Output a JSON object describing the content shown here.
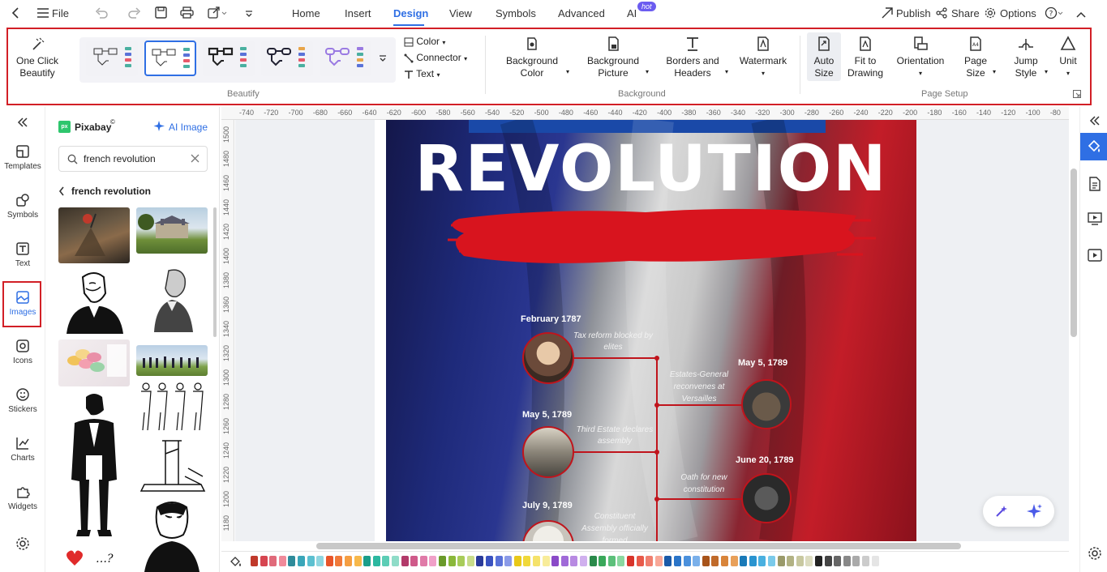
{
  "menubar": {
    "file": "File",
    "tabs": [
      "Home",
      "Insert",
      "Design",
      "View",
      "Symbols",
      "Advanced",
      "AI"
    ],
    "active_tab": "Design",
    "hot_badge": "hot",
    "publish": "Publish",
    "share": "Share",
    "options": "Options"
  },
  "ribbon": {
    "one_click_beautify": "One Click\nBeautify",
    "color": "Color",
    "connector": "Connector",
    "text": "Text",
    "beautify_group": "Beautify",
    "background_color": "Background\nColor",
    "background_picture": "Background\nPicture",
    "borders_headers": "Borders and\nHeaders",
    "watermark": "Watermark",
    "background_group": "Background",
    "auto_size": "Auto\nSize",
    "fit_to_drawing": "Fit to\nDrawing",
    "orientation": "Orientation",
    "page_size": "Page\nSize",
    "jump_style": "Jump\nStyle",
    "unit": "Unit",
    "page_setup_group": "Page Setup"
  },
  "rail": {
    "items": [
      "Templates",
      "Symbols",
      "Text",
      "Images",
      "Icons",
      "Stickers",
      "Charts",
      "Widgets"
    ],
    "active": "Images"
  },
  "panel": {
    "source": "Pixabay",
    "ai_image": "AI Image",
    "search_value": "french revolution",
    "breadcrumb": "french revolution"
  },
  "ruler": {
    "h_ticks": [
      "-740",
      "-720",
      "-700",
      "-680",
      "-660",
      "-640",
      "-620",
      "-600",
      "-580",
      "-560",
      "-540",
      "-520",
      "-500",
      "-480",
      "-460",
      "-440",
      "-420",
      "-400",
      "-380",
      "-360",
      "-340",
      "-320",
      "-300",
      "-280",
      "-260",
      "-240",
      "-220",
      "-200",
      "-180",
      "-160",
      "-140",
      "-120",
      "-100",
      "-80"
    ],
    "v_ticks": [
      "1500",
      "1480",
      "1460",
      "1440",
      "1420",
      "1400",
      "1380",
      "1360",
      "1340",
      "1320",
      "1300",
      "1280",
      "1260",
      "1240",
      "1220",
      "1200",
      "1180"
    ]
  },
  "poster": {
    "title": "REVOLUTION",
    "events": [
      {
        "date": "February 1787",
        "caption": "Tax reform blocked by elites"
      },
      {
        "date": "May 5, 1789",
        "caption": "Estates-General reconvenes at Versailles"
      },
      {
        "date": "May 5, 1789",
        "caption": "Third Estate declares assembly"
      },
      {
        "date": "June 20, 1789",
        "caption": "Oath for new constitution"
      },
      {
        "date": "July 9, 1789",
        "caption": "Constituent Assembly officially formed"
      }
    ]
  },
  "palette": {
    "colors": [
      "#c0392b",
      "#d64550",
      "#e06a7a",
      "#f08a9a",
      "#2e8b9a",
      "#3aa6b9",
      "#5cc0d0",
      "#8fd6e0",
      "#e8552a",
      "#f07a3a",
      "#f59e42",
      "#f7b84b",
      "#1a9e8a",
      "#2cb8a0",
      "#5ccdb5",
      "#8fdcc8",
      "#b23a6a",
      "#cf5a8a",
      "#e07aa8",
      "#f0a0c8",
      "#6a9a2a",
      "#8ab83a",
      "#a8cc5a",
      "#c8dc8a",
      "#2a3a9a",
      "#3a52c0",
      "#5a72d8",
      "#8a9ae8",
      "#e8c81a",
      "#f0d83a",
      "#f5e26a",
      "#f8ec9a",
      "#8a4ac8",
      "#a06ad8",
      "#b88ae2",
      "#d0b0ee",
      "#2a8a4a",
      "#3aa85a",
      "#5cc07a",
      "#8ad8a0",
      "#d8342a",
      "#e85a4a",
      "#f08070",
      "#f8a898",
      "#1a5aa8",
      "#2a74c8",
      "#4a90dc",
      "#7ab0ea",
      "#a8541a",
      "#c06a2a",
      "#d8843a",
      "#e8a05a",
      "#1a7ab8",
      "#2a94d0",
      "#4ab0e0",
      "#7acaea",
      "#9a9a6a",
      "#b2b284",
      "#c8c8a0",
      "#dcdcc0",
      "#222222",
      "#444444",
      "#666666",
      "#888888",
      "#aaaaaa",
      "#cccccc",
      "#e5e5e5"
    ]
  }
}
